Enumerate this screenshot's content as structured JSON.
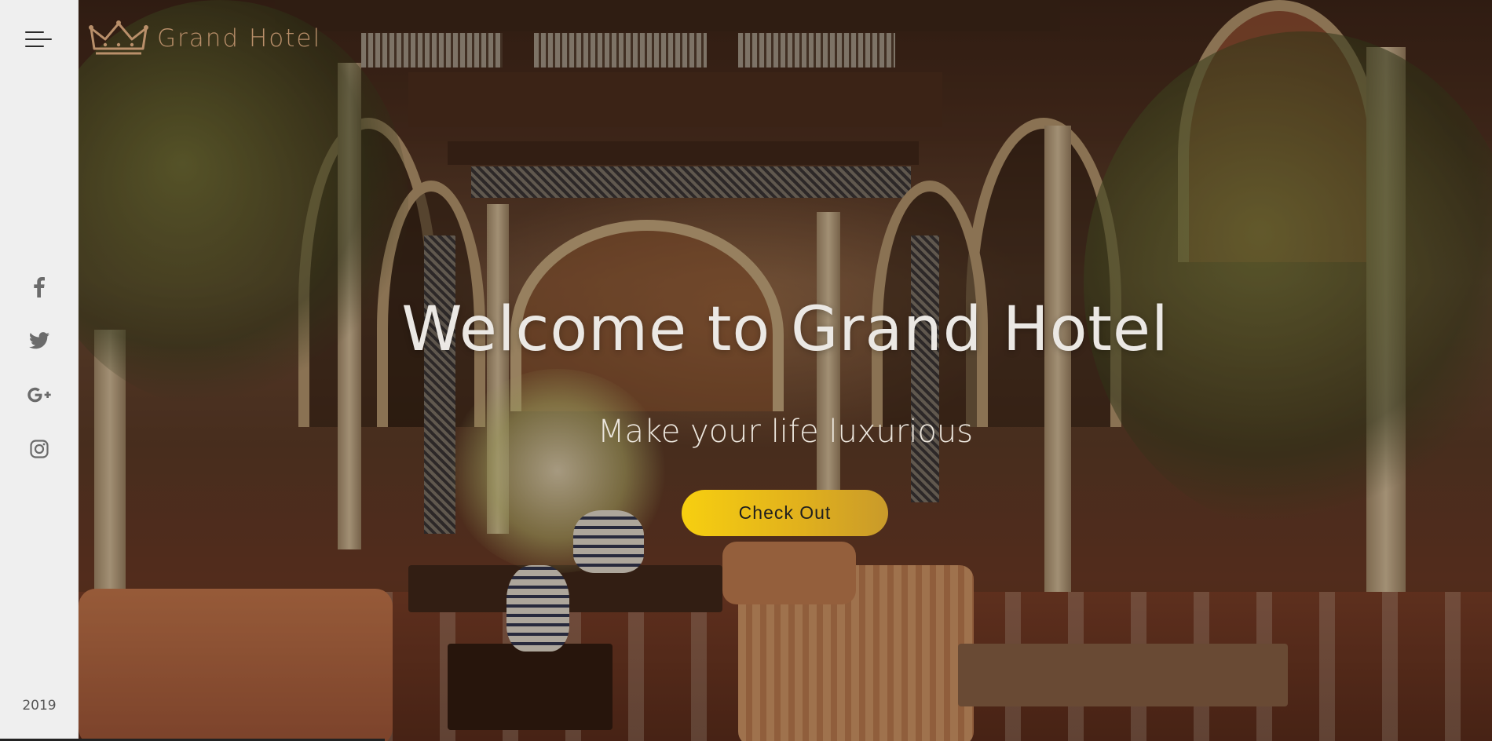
{
  "sidebar": {
    "menu_icon": "hamburger-menu-icon",
    "social": [
      {
        "name": "facebook",
        "icon": "facebook-icon"
      },
      {
        "name": "twitter",
        "icon": "twitter-icon"
      },
      {
        "name": "google-plus",
        "icon": "google-plus-icon"
      },
      {
        "name": "instagram",
        "icon": "instagram-icon"
      }
    ],
    "year": "2019"
  },
  "header": {
    "logo_icon": "crown-icon",
    "logo_text": "Grand Hotel"
  },
  "hero": {
    "title": "Welcome to Grand Hotel",
    "subtitle": "Make your life luxurious",
    "cta_label": "Check Out"
  },
  "colors": {
    "sidebar_bg": "#efefef",
    "logo": "#b98f6a",
    "cta_start": "#f7cf10",
    "cta_end": "#c99a2a",
    "hero_text": "#ebe8e4"
  }
}
